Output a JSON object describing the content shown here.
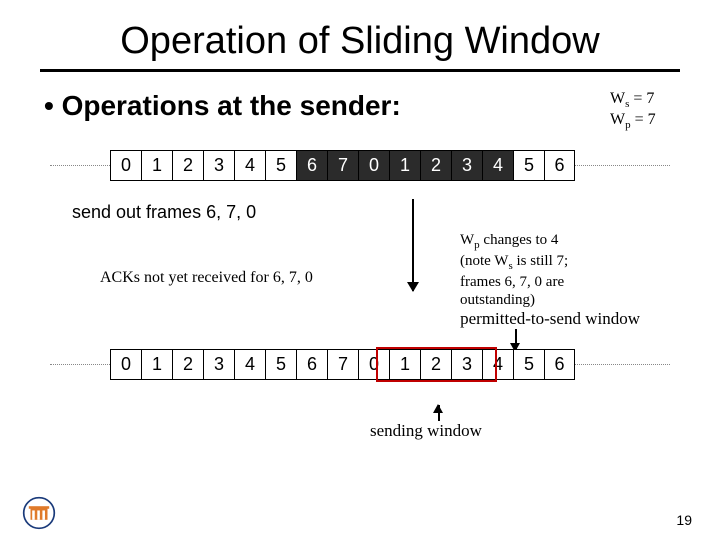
{
  "title": "Operation of Sliding Window",
  "bullet": "• Operations at the sender:",
  "ws_label_prefix": "W",
  "ws_sub": "s",
  "wp_sub": "p",
  "eq7": " = 7",
  "seq_top": [
    "0",
    "1",
    "2",
    "3",
    "4",
    "5",
    "6",
    "7",
    "0",
    "1",
    "2",
    "3",
    "4",
    "5",
    "6"
  ],
  "shadow_top_start": 6,
  "shadow_top_end": 12,
  "after_send": "send out frames 6, 7, 0",
  "acks_note": "ACKs not yet received for 6, 7, 0",
  "wp_change_lines": [
    "W<sub>p</sub> changes to 4",
    "(note W<sub>s</sub> is still 7;",
    "frames 6, 7, 0 are",
    "outstanding)"
  ],
  "wp_change_l1_a": "W",
  "wp_change_l1_b": " changes to 4",
  "wp_change_l2_a": "(note W",
  "wp_change_l2_b": " is still 7;",
  "wp_change_l3": "frames 6, 7, 0 are",
  "wp_change_l4": "outstanding)",
  "perm_label": "permitted-to-send window",
  "seq_bot": [
    "0",
    "1",
    "2",
    "3",
    "4",
    "5",
    "6",
    "7",
    "0",
    "1",
    "2",
    "3",
    "4",
    "5",
    "6"
  ],
  "red_box_start": 9,
  "red_box_len": 4,
  "swin_label": "sending window",
  "page_num": "19"
}
